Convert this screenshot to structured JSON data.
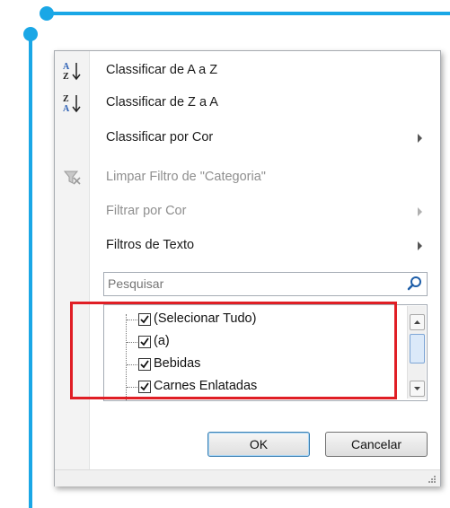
{
  "menu": {
    "items": [
      {
        "label": "Classificar de A a Z",
        "disabled": false,
        "submenu": false,
        "icon": "sort-az-icon"
      },
      {
        "label": "Classificar de Z a A",
        "disabled": false,
        "submenu": false,
        "icon": "sort-za-icon"
      },
      {
        "label": "Classificar por Cor",
        "disabled": false,
        "submenu": true,
        "icon": ""
      },
      {
        "label": "Limpar Filtro de \"Categoria\"",
        "disabled": true,
        "submenu": false,
        "icon": "clear-filter-icon"
      },
      {
        "label": "Filtrar por Cor",
        "disabled": true,
        "submenu": true,
        "icon": ""
      },
      {
        "label": "Filtros de Texto",
        "disabled": false,
        "submenu": true,
        "icon": ""
      }
    ]
  },
  "search": {
    "placeholder": "Pesquisar",
    "value": ""
  },
  "checklist": [
    {
      "label": "(Selecionar Tudo)",
      "checked": true
    },
    {
      "label": "(a)",
      "checked": true
    },
    {
      "label": "Bebidas",
      "checked": true
    },
    {
      "label": "Carnes Enlatadas",
      "checked": true
    }
  ],
  "buttons": {
    "ok": "OK",
    "cancel": "Cancelar"
  },
  "colors": {
    "accent_decoration": "#1aa7e6",
    "highlight_box": "#e01e25"
  }
}
